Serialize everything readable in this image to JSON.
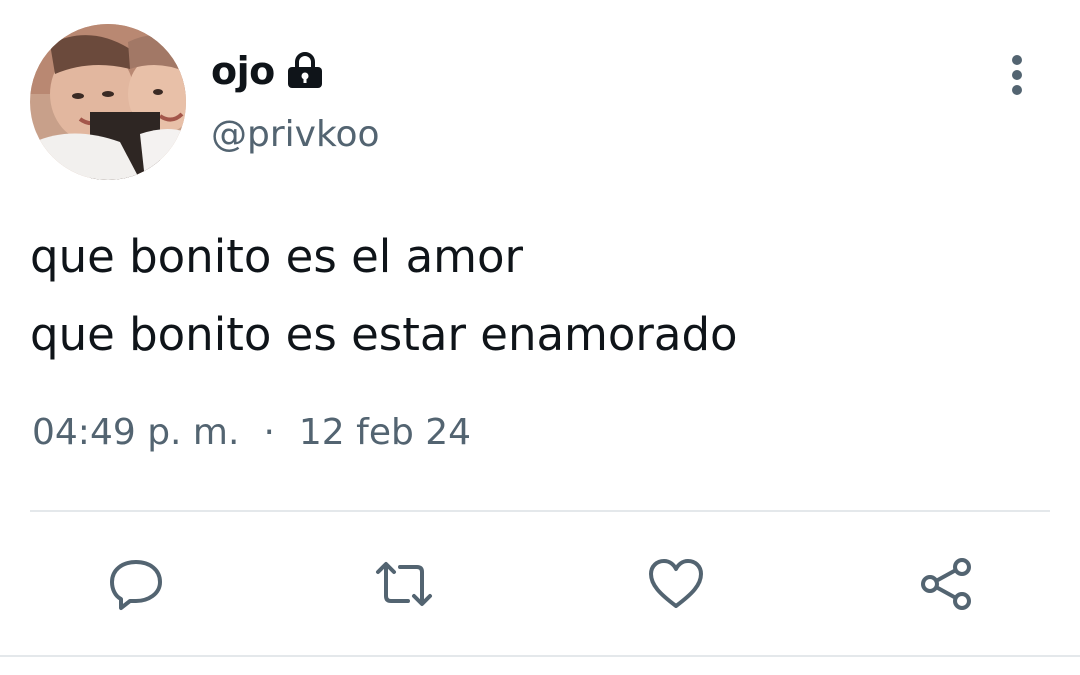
{
  "user": {
    "display_name": "ojo",
    "handle": "@privkoo",
    "protected_icon": "lock-icon",
    "avatar": "profile-photo"
  },
  "tweet": {
    "lines": [
      "que bonito es el amor",
      "que bonito es estar enamorado"
    ],
    "time": "04:49 p. m.",
    "separator": "·",
    "date": "12 feb 24"
  },
  "actions": [
    {
      "icon": "reply-icon"
    },
    {
      "icon": "retweet-icon"
    },
    {
      "icon": "like-icon"
    },
    {
      "icon": "share-icon"
    }
  ],
  "menu": {
    "icon": "more-vertical-icon"
  },
  "colors": {
    "text_primary": "#0f1419",
    "text_secondary": "#536471",
    "divider": "#e4e8eb"
  }
}
